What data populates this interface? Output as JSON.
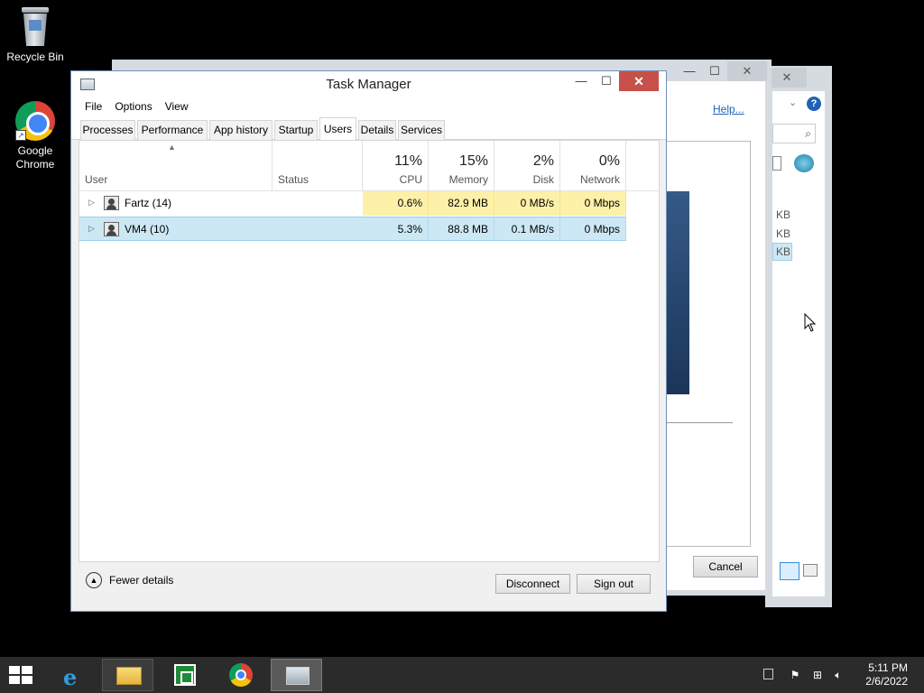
{
  "desktop": {
    "recycle_bin_label": "Recycle Bin",
    "chrome_label": "Google Chrome"
  },
  "background_windows": {
    "settings_help_link": "Help...",
    "settings_cancel_button": "Cancel",
    "explorer_size_values": [
      "KB",
      "KB",
      "KB"
    ]
  },
  "task_manager": {
    "title": "Task Manager",
    "menu": [
      "File",
      "Options",
      "View"
    ],
    "tabs": [
      "Processes",
      "Performance",
      "App history",
      "Startup",
      "Users",
      "Details",
      "Services"
    ],
    "active_tab": "Users",
    "columns": {
      "user": "User",
      "status": "Status",
      "cpu": {
        "pct": "11%",
        "label": "CPU"
      },
      "memory": {
        "pct": "15%",
        "label": "Memory"
      },
      "disk": {
        "pct": "2%",
        "label": "Disk"
      },
      "network": {
        "pct": "0%",
        "label": "Network"
      }
    },
    "rows": [
      {
        "user": "Fartz (14)",
        "status": "",
        "cpu": "0.6%",
        "memory": "82.9 MB",
        "disk": "0 MB/s",
        "network": "0 Mbps"
      },
      {
        "user": "VM4 (10)",
        "status": "",
        "cpu": "5.3%",
        "memory": "88.8 MB",
        "disk": "0.1 MB/s",
        "network": "0 Mbps"
      }
    ],
    "fewer_details": "Fewer details",
    "disconnect_button": "Disconnect",
    "sign_out_button": "Sign out"
  },
  "taskbar": {
    "time": "5:11 PM",
    "date": "2/6/2022"
  },
  "colors": {
    "cpu_heat": "#fdf0a9",
    "selection": "#cce8f4",
    "close_button": "#c7504b",
    "taskbar": "#2b2b2b"
  }
}
